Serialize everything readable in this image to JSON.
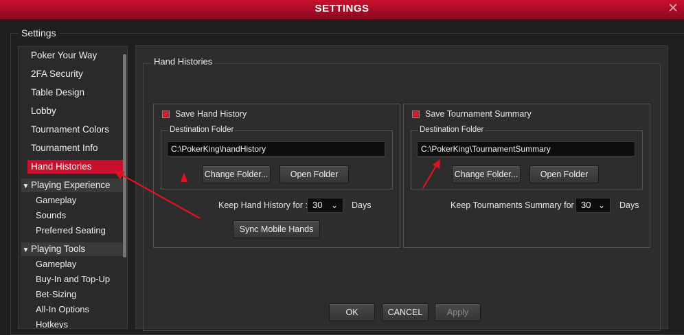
{
  "window": {
    "title": "SETTINGS",
    "close": "✕"
  },
  "settings_legend": "Settings",
  "sidebar": {
    "items": [
      "Poker Your Way",
      "2FA Security",
      "Table Design",
      "Lobby",
      "Tournament Colors",
      "Tournament Info",
      "Hand Histories"
    ],
    "active": "Hand Histories",
    "sections": [
      {
        "label": "Playing Experience",
        "children": [
          "Gameplay",
          "Sounds",
          "Preferred Seating"
        ]
      },
      {
        "label": "Playing Tools",
        "children": [
          "Gameplay",
          "Buy-In and Top-Up",
          "Bet-Sizing",
          "All-In Options",
          "Hotkeys"
        ]
      }
    ],
    "chevron": "▼"
  },
  "panel": {
    "legend": "Hand Histories",
    "hand_history": {
      "checkbox_label": "Save Hand History",
      "dest_label": "Destination Folder",
      "path": "C:\\PokerKing\\handHistory",
      "change_btn": "Change Folder...",
      "open_btn": "Open Folder",
      "keep_label": "Keep Hand History for :",
      "keep_value": "30",
      "days": "Days",
      "sync_btn": "Sync Mobile Hands"
    },
    "tournament": {
      "checkbox_label": "Save Tournament Summary",
      "dest_label": "Destination Folder",
      "path": "C:\\PokerKing\\TournamentSummary",
      "change_btn": "Change Folder...",
      "open_btn": "Open Folder",
      "keep_label": "Keep Tournaments Summary for :",
      "keep_value": "30",
      "days": "Days"
    }
  },
  "footer": {
    "ok": "OK",
    "cancel": "CANCEL",
    "apply": "Apply"
  },
  "colors": {
    "accent": "#c8102e",
    "annotation": "#e0141e",
    "background": "#1f1f1f",
    "panel": "#2d2d2d"
  }
}
